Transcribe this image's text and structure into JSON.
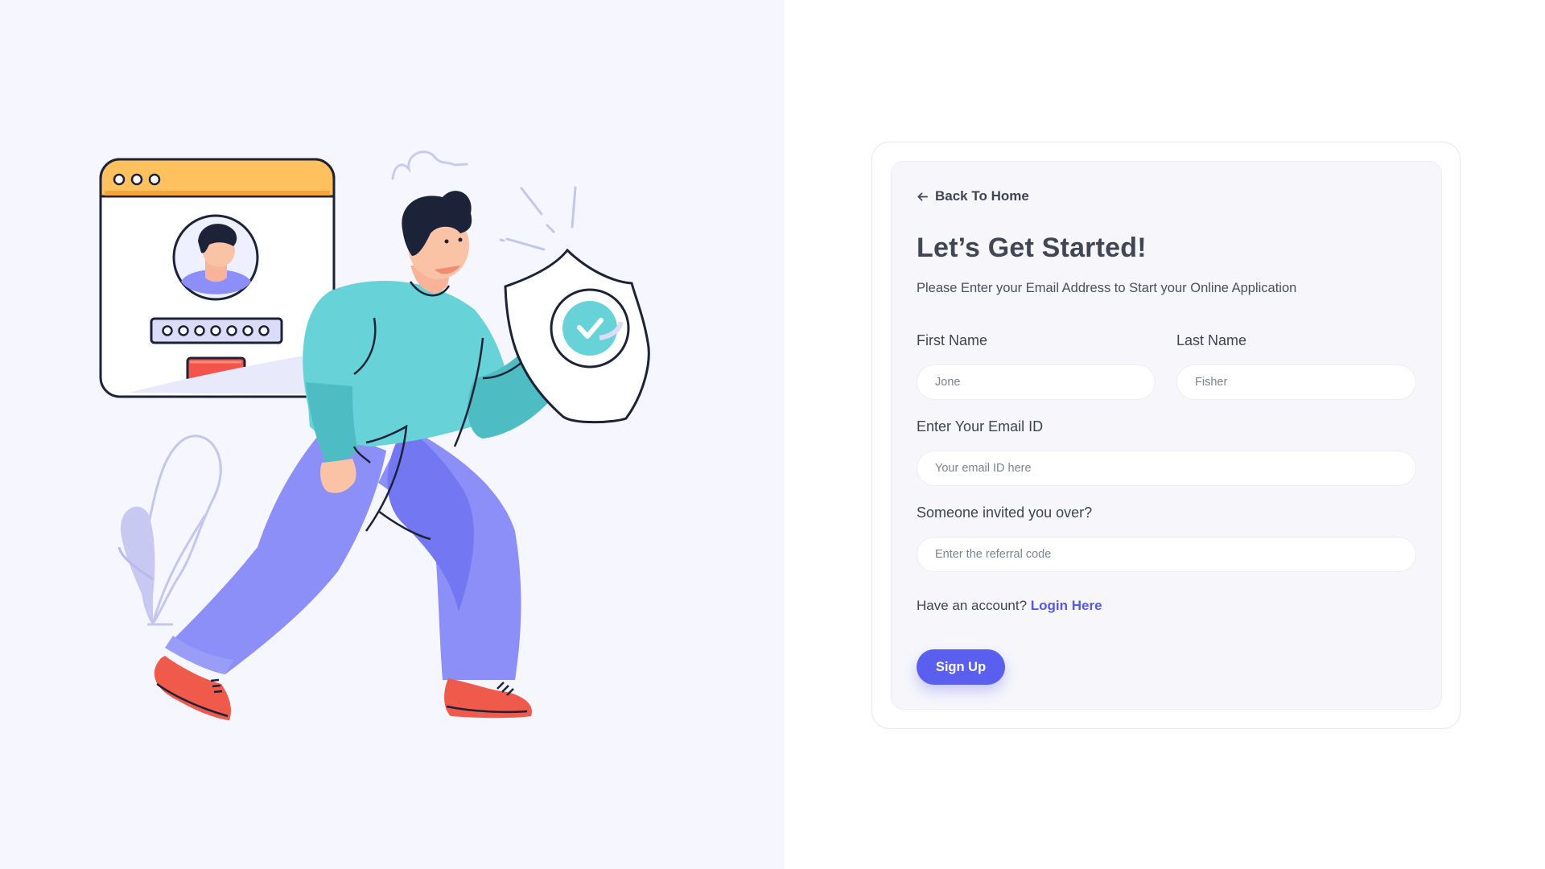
{
  "form": {
    "back_label": "Back To Home",
    "title": "Let’s Get Started!",
    "subtitle": "Please Enter your Email Address to Start your Online Application",
    "first_name": {
      "label": "First Name",
      "placeholder": "Jone"
    },
    "last_name": {
      "label": "Last Name",
      "placeholder": "Fisher"
    },
    "email": {
      "label": "Enter Your Email ID",
      "placeholder": "Your email ID here"
    },
    "referral": {
      "label": "Someone invited you over?",
      "placeholder": "Enter the referral code"
    },
    "account_prompt": "Have an account?",
    "login_link": "Login Here",
    "signup_label": "Sign Up"
  },
  "icons": {
    "back": "arrow-left-icon"
  },
  "colors": {
    "left_panel_bg": "#f6f6fe",
    "card_bg": "#f6f6fb",
    "accent": "#5a5ff0",
    "link": "#5559ea",
    "heading": "#404653",
    "shirt": "#67d3d8",
    "pants": "#8b8ff7",
    "shoes": "#ef5a4a",
    "browser_bar": "#ffc15e"
  }
}
